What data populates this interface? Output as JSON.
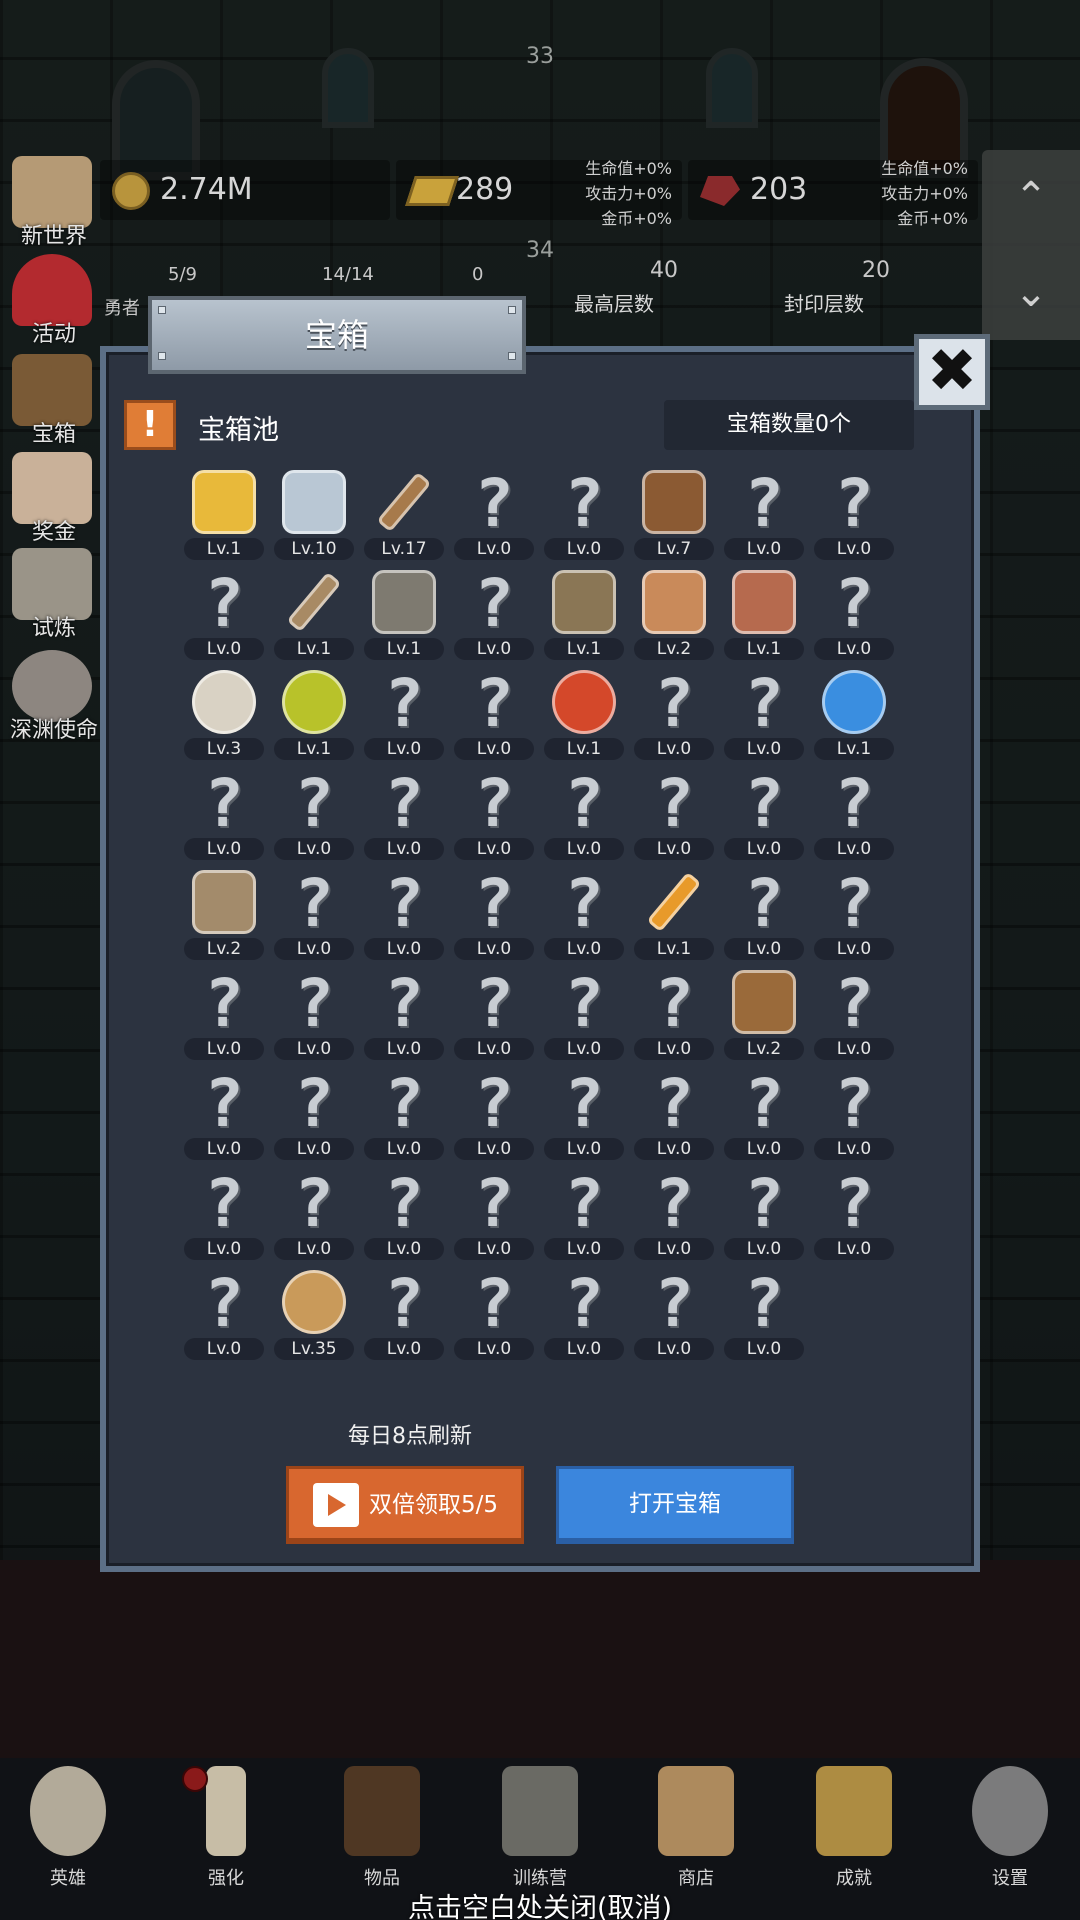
{
  "hud": {
    "floor_top": "33",
    "floor_mid": "34",
    "coins": "2.74M",
    "gold": "289",
    "gems": "203",
    "bonus_left": [
      "生命值+0%",
      "攻击力+0%",
      "金币+0%"
    ],
    "bonus_right": [
      "生命值+0%",
      "攻击力+0%",
      "金币+0%"
    ],
    "hero_count": "5/9",
    "hero_label": "勇者",
    "team_count": "14/14",
    "misc_count": "0",
    "max_floor": "40",
    "max_floor_label": "最高层数",
    "seal_floor": "20",
    "seal_floor_label": "封印层数",
    "scroll_up_icon": "chevron-up-icon",
    "scroll_down_icon": "chevron-down-icon"
  },
  "left_menu": [
    {
      "label": "新世界",
      "icon": "map-icon",
      "color": "#b59a75"
    },
    {
      "label": "活动",
      "icon": "heart-icon",
      "color": "#b32a2f"
    },
    {
      "label": "宝箱",
      "icon": "chest-icon",
      "color": "#7a5a36"
    },
    {
      "label": "奖金",
      "icon": "letter-icon",
      "color": "#c9b199"
    },
    {
      "label": "试炼",
      "icon": "feather-icon",
      "color": "#9a9488"
    },
    {
      "label": "深渊使命",
      "icon": "orb-icon",
      "color": "#8d8680"
    }
  ],
  "modal": {
    "title": "宝箱",
    "close_icon": "close-icon",
    "pool_title": "宝箱池",
    "chest_count": "宝箱数量0个",
    "refresh_text": "每日8点刷新",
    "double_button": "双倍领取5/5",
    "open_button": "打开宝箱",
    "items": [
      {
        "level": "Lv.1",
        "icon": "crown-icon",
        "color": "#e8b93a"
      },
      {
        "level": "Lv.10",
        "icon": "diamond-icon",
        "color": "#b9c7d4"
      },
      {
        "level": "Lv.17",
        "icon": "wooden-sword-icon",
        "color": "#a77a4b"
      },
      {
        "level": "Lv.0",
        "icon": "unknown"
      },
      {
        "level": "Lv.0",
        "icon": "unknown"
      },
      {
        "level": "Lv.7",
        "icon": "leather-armor-icon",
        "color": "#8b5a33"
      },
      {
        "level": "Lv.0",
        "icon": "unknown"
      },
      {
        "level": "Lv.0",
        "icon": "unknown"
      },
      {
        "level": "Lv.0",
        "icon": "unknown"
      },
      {
        "level": "Lv.1",
        "icon": "dagger-icon",
        "color": "#a88a64"
      },
      {
        "level": "Lv.1",
        "icon": "knight-helmet-icon",
        "color": "#7e7a70"
      },
      {
        "level": "Lv.0",
        "icon": "unknown"
      },
      {
        "level": "Lv.1",
        "icon": "great-helm-icon",
        "color": "#8a7655"
      },
      {
        "level": "Lv.2",
        "icon": "ham-icon",
        "color": "#c98a5a"
      },
      {
        "level": "Lv.1",
        "icon": "steak-icon",
        "color": "#b66a4e"
      },
      {
        "level": "Lv.0",
        "icon": "unknown"
      },
      {
        "level": "Lv.3",
        "icon": "flour-bowl-icon",
        "color": "#d9d2c4"
      },
      {
        "level": "Lv.1",
        "icon": "yellow-potion-icon",
        "color": "#b8c22a"
      },
      {
        "level": "Lv.0",
        "icon": "unknown"
      },
      {
        "level": "Lv.0",
        "icon": "unknown"
      },
      {
        "level": "Lv.1",
        "icon": "red-potion-icon",
        "color": "#d4482a"
      },
      {
        "level": "Lv.0",
        "icon": "unknown"
      },
      {
        "level": "Lv.0",
        "icon": "unknown"
      },
      {
        "level": "Lv.1",
        "icon": "blue-potion-icon",
        "color": "#3a8ee0"
      },
      {
        "level": "Lv.0",
        "icon": "unknown"
      },
      {
        "level": "Lv.0",
        "icon": "unknown"
      },
      {
        "level": "Lv.0",
        "icon": "unknown"
      },
      {
        "level": "Lv.0",
        "icon": "unknown"
      },
      {
        "level": "Lv.0",
        "icon": "unknown"
      },
      {
        "level": "Lv.0",
        "icon": "unknown"
      },
      {
        "level": "Lv.0",
        "icon": "unknown"
      },
      {
        "level": "Lv.0",
        "icon": "unknown"
      },
      {
        "level": "Lv.2",
        "icon": "boot-icon",
        "color": "#a38b6b"
      },
      {
        "level": "Lv.0",
        "icon": "unknown"
      },
      {
        "level": "Lv.0",
        "icon": "unknown"
      },
      {
        "level": "Lv.0",
        "icon": "unknown"
      },
      {
        "level": "Lv.0",
        "icon": "unknown"
      },
      {
        "level": "Lv.1",
        "icon": "torch-icon",
        "color": "#e89a2a"
      },
      {
        "level": "Lv.0",
        "icon": "unknown"
      },
      {
        "level": "Lv.0",
        "icon": "unknown"
      },
      {
        "level": "Lv.0",
        "icon": "unknown"
      },
      {
        "level": "Lv.0",
        "icon": "unknown"
      },
      {
        "level": "Lv.0",
        "icon": "unknown"
      },
      {
        "level": "Lv.0",
        "icon": "unknown"
      },
      {
        "level": "Lv.0",
        "icon": "unknown"
      },
      {
        "level": "Lv.0",
        "icon": "unknown"
      },
      {
        "level": "Lv.2",
        "icon": "backpack-icon",
        "color": "#9a6a3a"
      },
      {
        "level": "Lv.0",
        "icon": "unknown"
      },
      {
        "level": "Lv.0",
        "icon": "unknown"
      },
      {
        "level": "Lv.0",
        "icon": "unknown"
      },
      {
        "level": "Lv.0",
        "icon": "unknown"
      },
      {
        "level": "Lv.0",
        "icon": "unknown"
      },
      {
        "level": "Lv.0",
        "icon": "unknown"
      },
      {
        "level": "Lv.0",
        "icon": "unknown"
      },
      {
        "level": "Lv.0",
        "icon": "unknown"
      },
      {
        "level": "Lv.0",
        "icon": "unknown"
      },
      {
        "level": "Lv.0",
        "icon": "unknown"
      },
      {
        "level": "Lv.0",
        "icon": "unknown"
      },
      {
        "level": "Lv.0",
        "icon": "unknown"
      },
      {
        "level": "Lv.0",
        "icon": "unknown"
      },
      {
        "level": "Lv.0",
        "icon": "unknown"
      },
      {
        "level": "Lv.0",
        "icon": "unknown"
      },
      {
        "level": "Lv.0",
        "icon": "unknown"
      },
      {
        "level": "Lv.0",
        "icon": "unknown"
      },
      {
        "level": "Lv.0",
        "icon": "unknown"
      },
      {
        "level": "Lv.35",
        "icon": "beer-mug-icon",
        "color": "#c99a5a"
      },
      {
        "level": "Lv.0",
        "icon": "unknown"
      },
      {
        "level": "Lv.0",
        "icon": "unknown"
      },
      {
        "level": "Lv.0",
        "icon": "unknown"
      },
      {
        "level": "Lv.0",
        "icon": "unknown"
      },
      {
        "level": "Lv.0",
        "icon": "unknown"
      }
    ]
  },
  "bottom_nav": [
    {
      "label": "英雄",
      "icon": "skull-icon",
      "color": "#cfc5b0"
    },
    {
      "label": "强化",
      "icon": "candle-icon",
      "color": "#e8dcc0"
    },
    {
      "label": "物品",
      "icon": "book-icon",
      "color": "#5a3e26"
    },
    {
      "label": "训练营",
      "icon": "lantern-icon",
      "color": "#7a7a72"
    },
    {
      "label": "商店",
      "icon": "beer-mug-icon",
      "color": "#c9a06a"
    },
    {
      "label": "成就",
      "icon": "key-icon",
      "color": "#c9a24a"
    },
    {
      "label": "设置",
      "icon": "gear-icon",
      "color": "#8e8e8e"
    }
  ],
  "close_hint": "点击空白处关闭(取消)"
}
